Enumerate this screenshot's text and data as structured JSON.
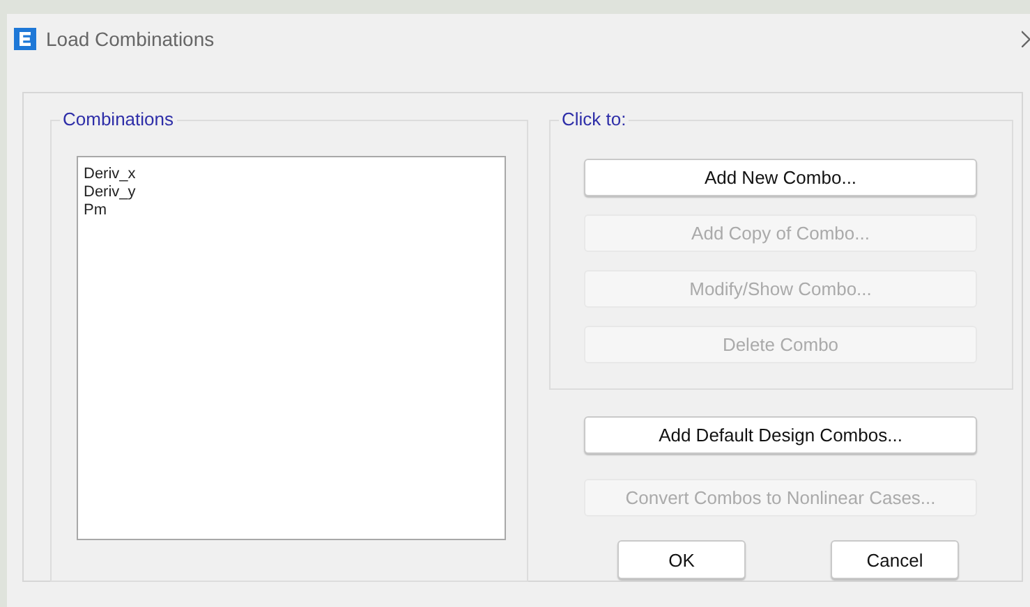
{
  "window": {
    "title": "Load Combinations"
  },
  "combinations": {
    "title": "Combinations",
    "items": [
      "Deriv_x",
      "Deriv_y",
      "Pm"
    ]
  },
  "click_to": {
    "title": "Click to:",
    "buttons": [
      {
        "label": "Add New Combo...",
        "disabled": false
      },
      {
        "label": "Add Copy of Combo...",
        "disabled": true
      },
      {
        "label": "Modify/Show Combo...",
        "disabled": true
      },
      {
        "label": "Delete Combo",
        "disabled": true
      }
    ]
  },
  "extra_buttons": [
    {
      "label": "Add Default Design Combos...",
      "disabled": false
    },
    {
      "label": "Convert Combos to Nonlinear Cases...",
      "disabled": true
    }
  ],
  "dialog_buttons": [
    {
      "label": "OK",
      "disabled": false
    },
    {
      "label": "Cancel",
      "disabled": false
    }
  ]
}
